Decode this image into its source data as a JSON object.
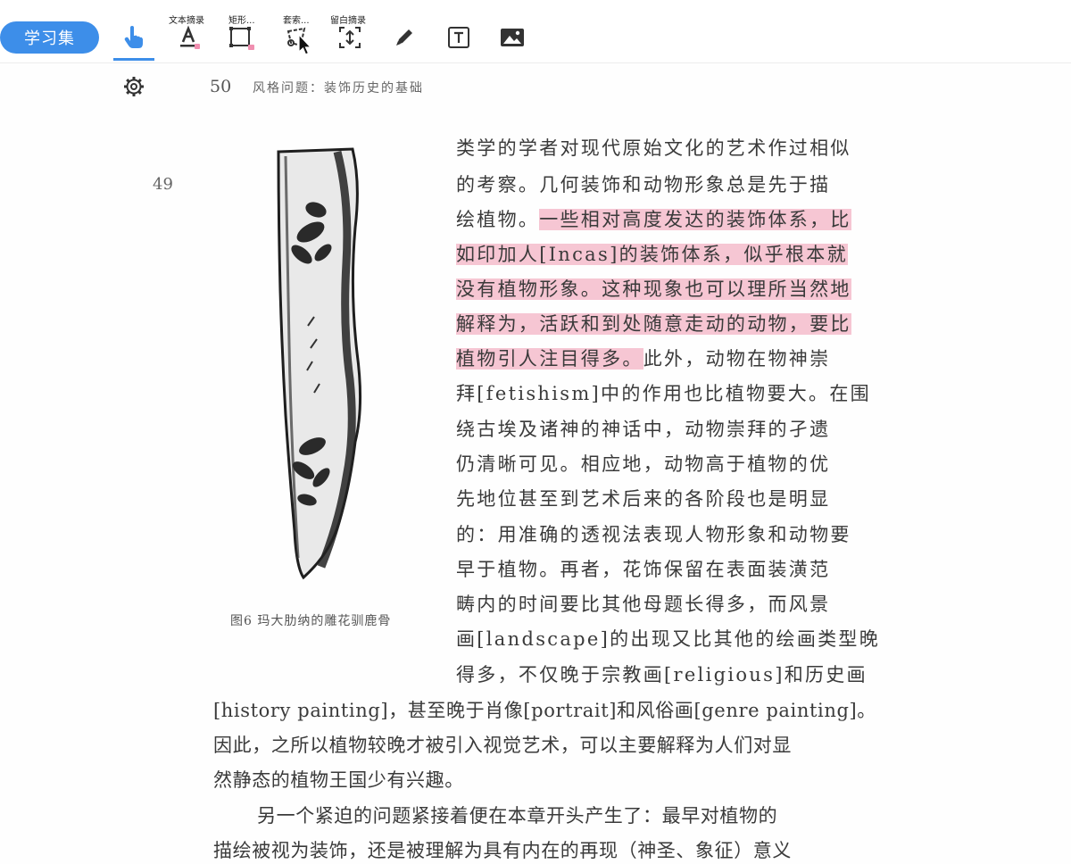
{
  "toolbar": {
    "study_set_label": "学习集",
    "tools": [
      {
        "name": "hand-tool",
        "label": ""
      },
      {
        "name": "text-excerpt",
        "label": "文本摘录"
      },
      {
        "name": "rect-excerpt",
        "label": "矩形..."
      },
      {
        "name": "lasso-excerpt",
        "label": "套索..."
      },
      {
        "name": "margin-excerpt",
        "label": "留白摘录"
      },
      {
        "name": "pen-tool",
        "label": ""
      },
      {
        "name": "text-box-tool",
        "label": ""
      },
      {
        "name": "image-tool",
        "label": ""
      }
    ],
    "accent": "#3d8ee9"
  },
  "page": {
    "page_number": "50",
    "running_head": "风格问题：装饰历史的基础",
    "margin_number": "49",
    "caption": "图6 玛大肋纳的雕花驯鹿骨",
    "highlight_color": "#f6c6d3",
    "lines": {
      "l1": "类学的学者对现代原始文化的艺术作过相似",
      "l2": "的考察。几何装饰和动物形象总是先于描",
      "l3a": "绘植物。",
      "l3b": "一些相对高度发达的装饰体系，比",
      "l4": "如印加人[Incas]的装饰体系，似乎根本就",
      "l5": "没有植物形象。这种现象也可以理所当然地",
      "l6": "解释为，活跃和到处随意走动的动物，要比",
      "l7a": "植物引人注目得多。",
      "l7b": "此外，动物在物神崇",
      "l8": "拜[fetishism]中的作用也比植物要大。在围",
      "l9": "绕古埃及诸神的神话中，动物崇拜的孑遗",
      "l10": "仍清晰可见。相应地，动物高于植物的优",
      "l11": "先地位甚至到艺术后来的各阶段也是明显",
      "l12": "的：用准确的透视法表现人物形象和动物要",
      "l13": "早于植物。再者，花饰保留在表面装潢范",
      "l14": "畴内的时间要比其他母题长得多，而风景",
      "l15": "画[landscape]的出现又比其他的绘画类型晚",
      "l16": "得多，不仅晚于宗教画[religious]和历史画",
      "l17": "[history painting]，甚至晚于肖像[portrait]和风俗画[genre painting]。",
      "l18": "因此，之所以植物较晚才被引入视觉艺术，可以主要解释为人们对显",
      "l19": "然静态的植物王国少有兴趣。",
      "l20": "另一个紧迫的问题紧接着便在本章开头产生了：最早对植物的",
      "l21": "描绘被视为装饰，还是被理解为具有内在的再现（神圣、象征）意义"
    }
  }
}
